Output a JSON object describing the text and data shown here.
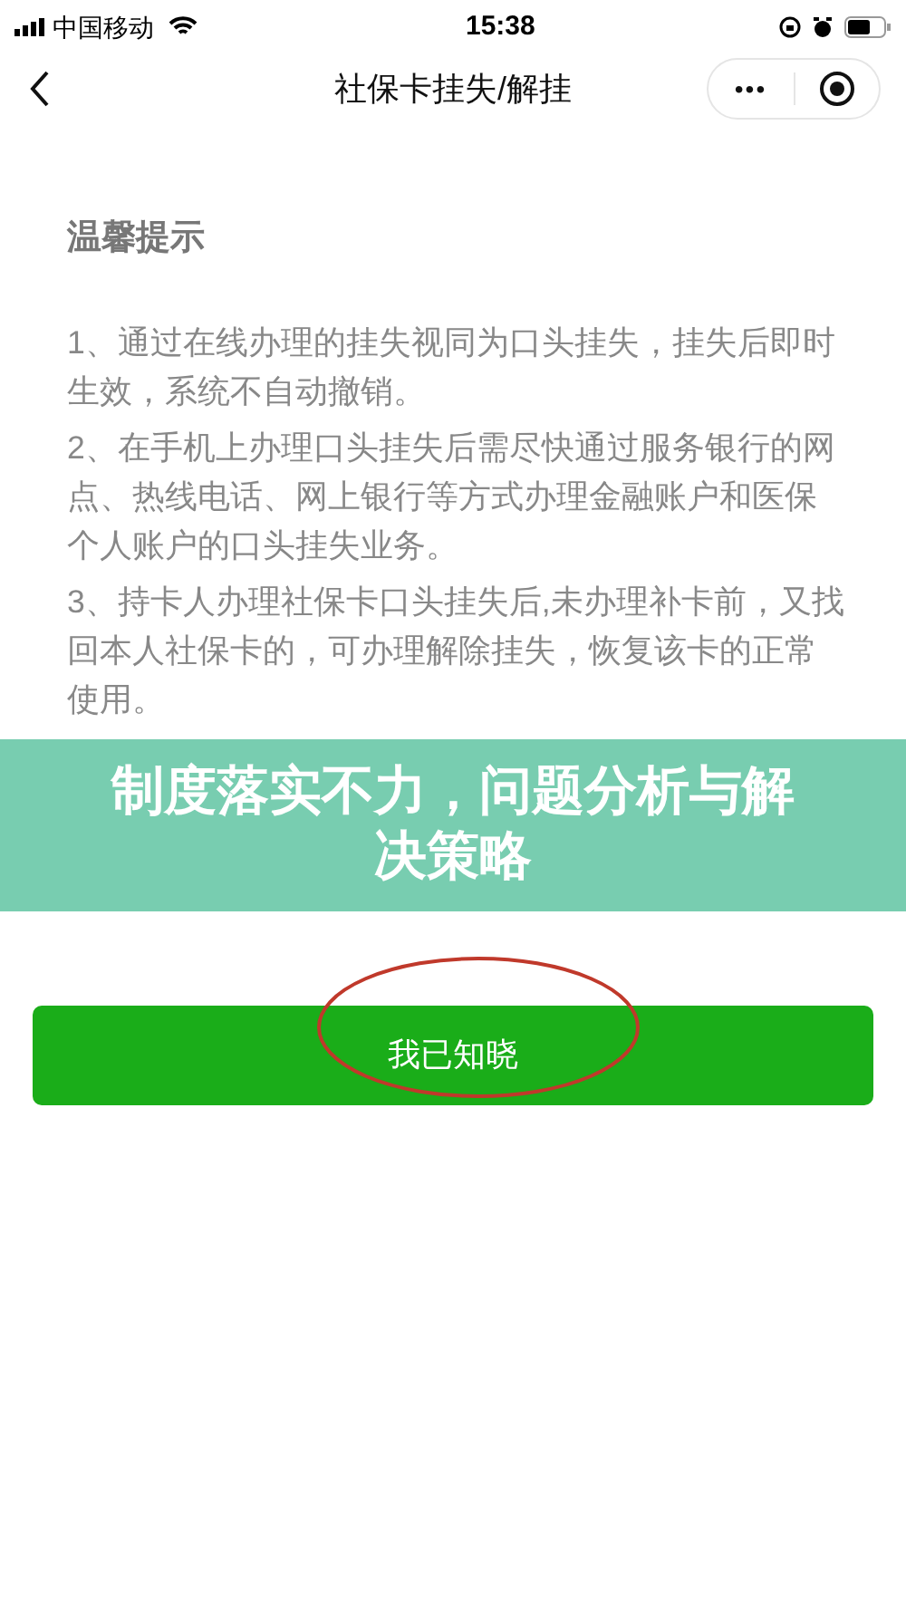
{
  "status_bar": {
    "carrier": "中国移动",
    "time": "15:38"
  },
  "nav_bar": {
    "title": "社保卡挂失/解挂",
    "more": "•••"
  },
  "notice": {
    "title": "温馨提示",
    "paragraphs": [
      "1、通过在线办理的挂失视同为口头挂失，挂失后即时生效，系统不自动撤销。",
      "2、在手机上办理口头挂失后需尽快通过服务银行的网点、热线电话、网上银行等方式办理金融账户和医保个人账户的口头挂失业务。",
      "3、持卡人办理社保卡口头挂失后,未办理补卡前，又找回本人社保卡的，可办理解除挂失，恢复该卡的正常使用。"
    ]
  },
  "banner": {
    "title": "制度落实不力，问题分析与解决策略"
  },
  "confirm_button": {
    "label": "我已知晓",
    "circled": true
  }
}
